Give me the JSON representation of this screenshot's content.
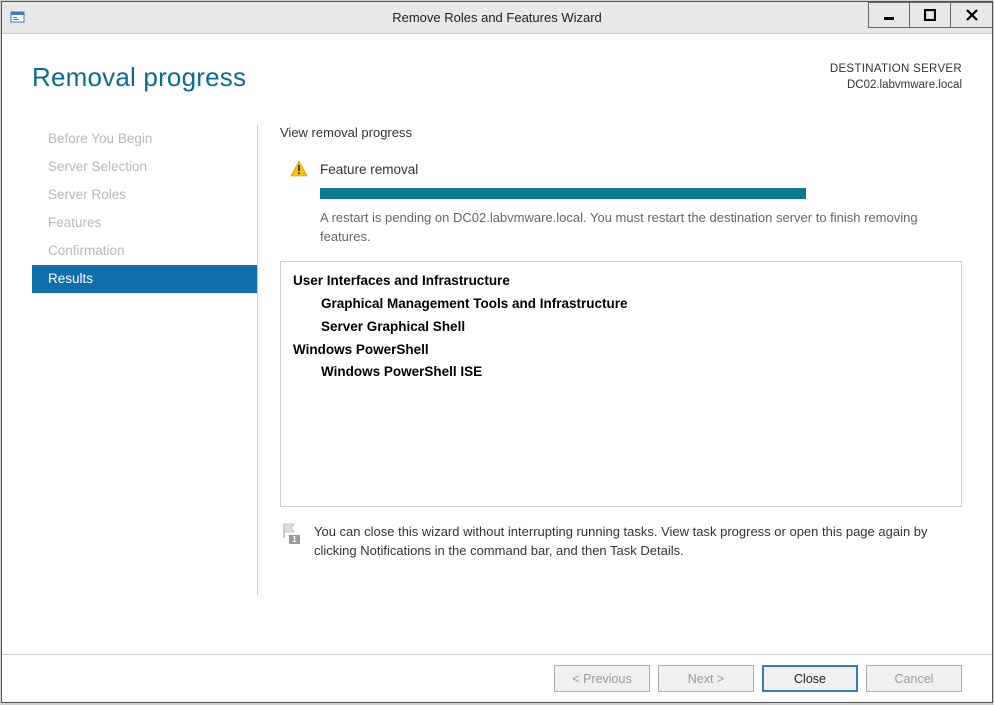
{
  "window": {
    "title": "Remove Roles and Features Wizard"
  },
  "header": {
    "page_title": "Removal progress",
    "destination_label": "DESTINATION SERVER",
    "destination_value": "DC02.labvmware.local"
  },
  "sidebar": {
    "items": [
      {
        "label": "Before You Begin",
        "active": false
      },
      {
        "label": "Server Selection",
        "active": false
      },
      {
        "label": "Server Roles",
        "active": false
      },
      {
        "label": "Features",
        "active": false
      },
      {
        "label": "Confirmation",
        "active": false
      },
      {
        "label": "Results",
        "active": true
      }
    ]
  },
  "main": {
    "instruction": "View removal progress",
    "status_title": "Feature removal",
    "progress_percent": 100,
    "restart_message": "A restart is pending on DC02.labvmware.local. You must restart the destination server to finish removing features.",
    "feature_tree": [
      {
        "label": "User Interfaces and Infrastructure",
        "level": 0
      },
      {
        "label": "Graphical Management Tools and Infrastructure",
        "level": 1
      },
      {
        "label": "Server Graphical Shell",
        "level": 1
      },
      {
        "label": "Windows PowerShell",
        "level": 0
      },
      {
        "label": "Windows PowerShell ISE",
        "level": 1
      }
    ],
    "note": "You can close this wizard without interrupting running tasks. View task progress or open this page again by clicking Notifications in the command bar, and then Task Details."
  },
  "footer": {
    "previous": "< Previous",
    "next": "Next >",
    "close": "Close",
    "cancel": "Cancel"
  }
}
